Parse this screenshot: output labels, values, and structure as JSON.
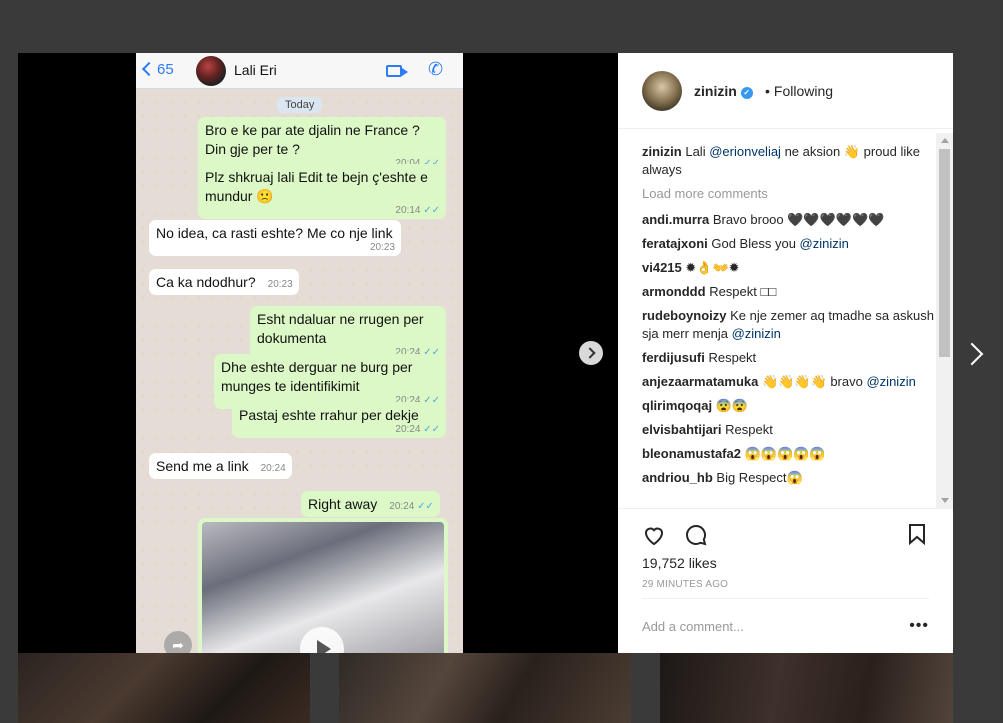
{
  "chat": {
    "back_count": "65",
    "contact_name": "Lali Eri",
    "day_label": "Today",
    "messages": [
      {
        "text": "Bro e ke par ate djalin ne France ? Din gje per te ?",
        "time": "20:04"
      },
      {
        "text": "Plz shkruaj lali Edit te bejn ç'eshte e mundur 🙁",
        "time": "20:14"
      },
      {
        "text": "No idea, ca rasti eshte? Me co nje link",
        "time": "20:23"
      },
      {
        "text": "Ca ka ndodhur?",
        "time": "20:23"
      },
      {
        "text": "Esht ndaluar ne rrugen per dokumenta",
        "time": "20:24"
      },
      {
        "text": "Dhe eshte derguar ne burg per munges te identifikimit",
        "time": "20:24"
      },
      {
        "text": "Pastaj eshte rrahur per dekje",
        "time": "20:24"
      },
      {
        "text": "Send me a link",
        "time": "20:24"
      },
      {
        "text": "Right away",
        "time": "20:24"
      }
    ]
  },
  "post": {
    "username": "zinizin",
    "following_label": "Following",
    "caption": {
      "user": "zinizin",
      "before": "Lali",
      "mention": "@erionveliaj",
      "after": "ne aksion 👋 proud like always"
    },
    "load_more": "Load more comments",
    "comments": [
      {
        "user": "andi.murra",
        "text": "Bravo brooo 🖤🖤🖤🖤🖤🖤",
        "mention": ""
      },
      {
        "user": "feratajxoni",
        "text": "God Bless you",
        "mention": "@zinizin"
      },
      {
        "user": "vi4215",
        "text": "✹👌👐✹",
        "mention": ""
      },
      {
        "user": "armonddd",
        "text": "Respekt □□",
        "mention": ""
      },
      {
        "user": "rudeboynoizy",
        "text": "Ke nje zemer aq tmadhe sa askush sja merr menja",
        "mention": "@zinizin"
      },
      {
        "user": "ferdijusufi",
        "text": "Respekt",
        "mention": ""
      },
      {
        "user": "anjezaarmatamuka",
        "text": "👋👋👋👋 bravo",
        "mention": "@zinizin"
      },
      {
        "user": "qlirimqoqaj",
        "text": "😨😨",
        "mention": ""
      },
      {
        "user": "elvisbahtijari",
        "text": "Respekt",
        "mention": ""
      },
      {
        "user": "bleonamustafa2",
        "text": "😱😱😱😱😱",
        "mention": ""
      },
      {
        "user": "andriou_hb",
        "text": "Big Respect😱",
        "mention": ""
      }
    ],
    "likes": "19,752 likes",
    "time_ago": "29 MINUTES AGO",
    "add_comment_placeholder": "Add a comment...",
    "more_label": "•••"
  },
  "colors": {
    "accent": "#3897f0",
    "mention": "#003569",
    "wa_out": "#dcf8c6",
    "wa_link": "#2b7cf6"
  }
}
